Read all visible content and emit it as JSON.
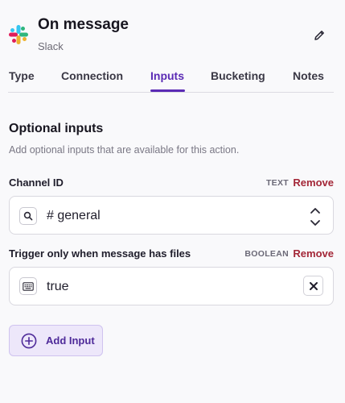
{
  "header": {
    "title": "On message",
    "subtitle": "Slack",
    "app_icon": "slack-logo",
    "edit_icon": "pencil-icon"
  },
  "tabs": [
    {
      "label": "Type",
      "active": false
    },
    {
      "label": "Connection",
      "active": false
    },
    {
      "label": "Inputs",
      "active": true
    },
    {
      "label": "Bucketing",
      "active": false
    },
    {
      "label": "Notes",
      "active": false
    }
  ],
  "section": {
    "title": "Optional inputs",
    "description": "Add optional inputs that are available for this action."
  },
  "fields": [
    {
      "label": "Channel ID",
      "type": "TEXT",
      "remove_label": "Remove",
      "value": "# general",
      "icon": "search-icon",
      "control": "chevron-up-down-icon"
    },
    {
      "label": "Trigger only when message has files",
      "type": "BOOLEAN",
      "remove_label": "Remove",
      "value": "true",
      "icon": "keyboard-icon",
      "control": "close-icon"
    }
  ],
  "add_button": {
    "label": "Add Input",
    "icon": "plus-circle-icon"
  },
  "colors": {
    "accent": "#5b2bb5",
    "remove": "#a32637",
    "add_button_bg": "#ede7fa"
  }
}
